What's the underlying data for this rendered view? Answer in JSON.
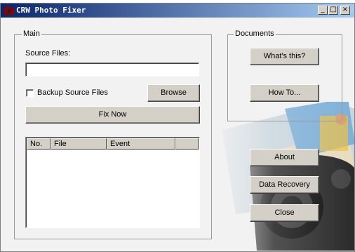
{
  "window": {
    "title": "CRW Photo Fixer",
    "controls": [
      "_",
      "□",
      "×"
    ]
  },
  "main": {
    "legend": "Main",
    "source_label": "Source Files:",
    "source_value": "",
    "backup_label": "Backup Source Files",
    "backup_checked": false,
    "browse_label": "Browse",
    "fix_now_label": "Fix Now",
    "table": {
      "columns": [
        "No.",
        "File",
        "Event"
      ],
      "rows": []
    }
  },
  "documents": {
    "legend": "Documents",
    "whats_this_label": "What's this?",
    "how_to_label": "How To..."
  },
  "actions": {
    "about_label": "About",
    "data_recovery_label": "Data Recovery",
    "close_label": "Close"
  },
  "colors": {
    "titlebar_start": "#0a246a",
    "titlebar_end": "#a6caf0",
    "button_face": "#d4d0c8"
  }
}
